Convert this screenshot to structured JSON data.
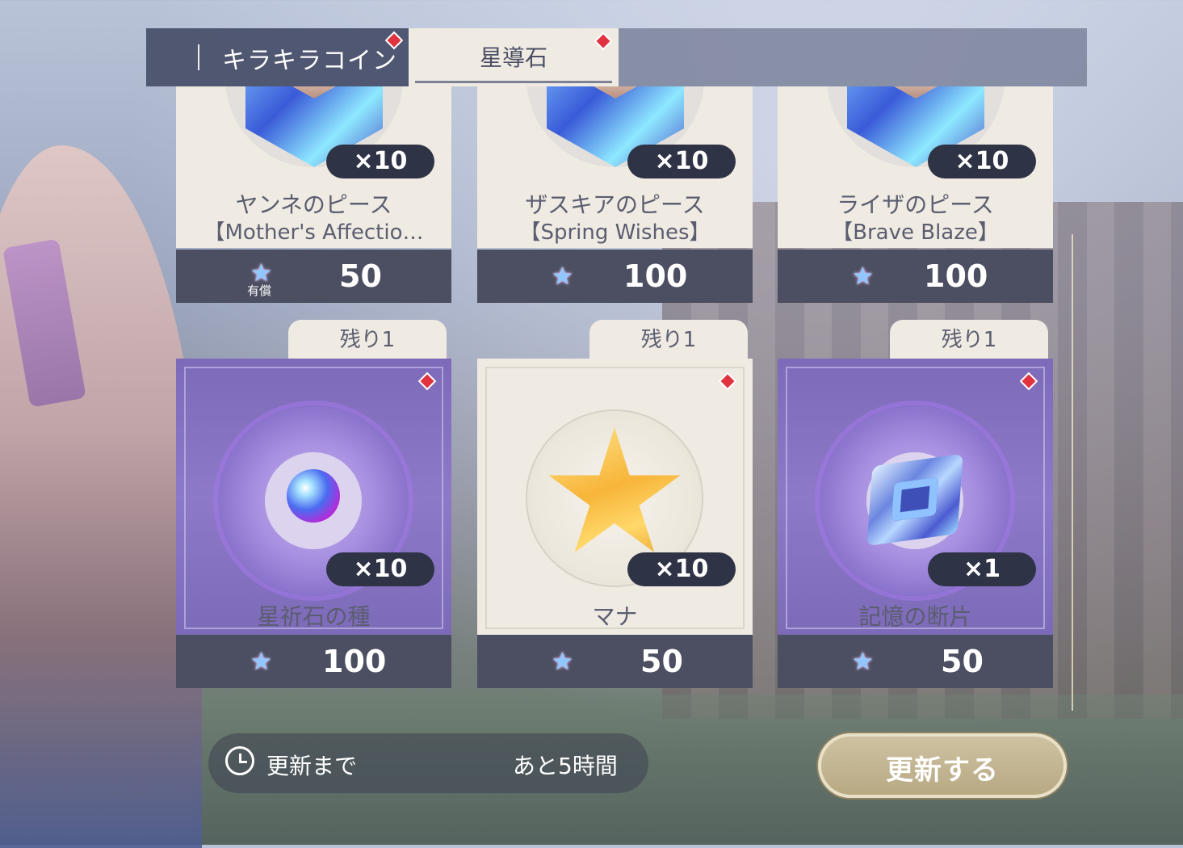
{
  "tabs": {
    "coin_label": "キラキラコイン",
    "star_label": "星導石"
  },
  "top_items": [
    {
      "qty": "×10",
      "name": "ヤンネのピース",
      "sub": "【Mother's Affectio…",
      "price": "50",
      "paid_label": "有償"
    },
    {
      "qty": "×10",
      "name": "ザスキアのピース",
      "sub": "【Spring Wishes】",
      "price": "100"
    },
    {
      "qty": "×10",
      "name": "ライザのピース",
      "sub": "【Brave Blaze】",
      "price": "100"
    }
  ],
  "bottom_items": [
    {
      "remaining": "残り1",
      "qty": "×10",
      "name": "星祈石の種",
      "price": "100"
    },
    {
      "remaining": "残り1",
      "qty": "×10",
      "name": "マナ",
      "price": "50"
    },
    {
      "remaining": "残り1",
      "qty": "×1",
      "name": "記憶の断片",
      "price": "50"
    }
  ],
  "timer": {
    "label": "更新まで",
    "value": "あと5時間"
  },
  "refresh_button": "更新する",
  "icons": {
    "currency": "star-stone-icon",
    "timer": "clock-icon",
    "new_badge": "red-diamond-badge"
  },
  "colors": {
    "accent_red": "#e0323f",
    "price_bar": "#4b4f61",
    "card_cream": "#efeae2",
    "card_purple": "#8573c0"
  }
}
